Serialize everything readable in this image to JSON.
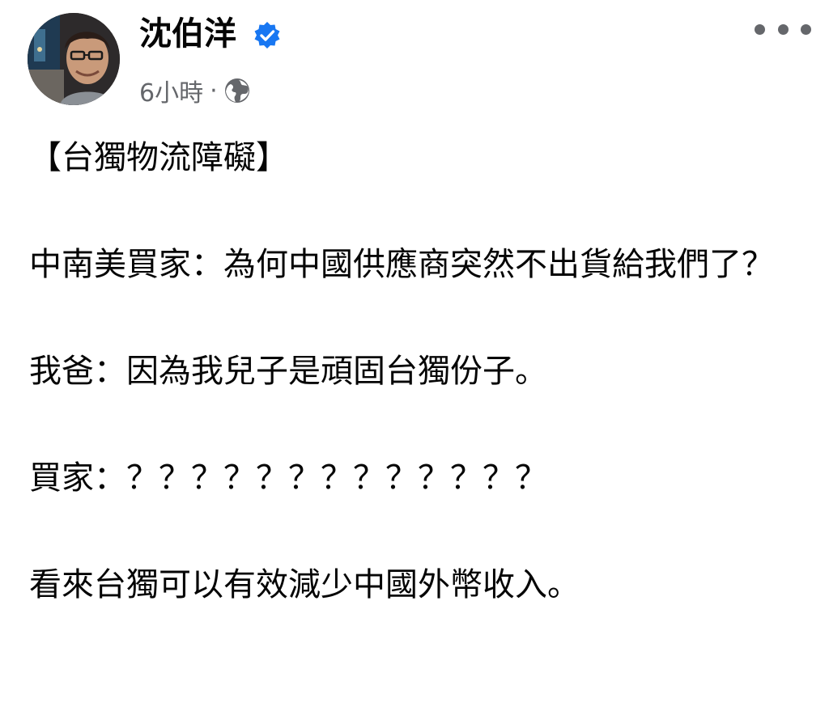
{
  "post": {
    "author": {
      "name": "沈伯洋",
      "verified": true,
      "avatar_icon": "profile-photo"
    },
    "meta": {
      "time": "6小時",
      "separator": "·",
      "audience_icon": "globe-icon"
    },
    "menu_icon": "more-horizontal-icon",
    "body": {
      "title": "【台獨物流障礙】",
      "paragraph_1": "中南美買家：為何中國供應商突然不出貨給我們了？",
      "paragraph_2": "我爸：因為我兒子是頑固台獨份子。",
      "paragraph_3": "買家：？？？？？？？？？？？？？",
      "paragraph_4": "看來台獨可以有效減少中國外幣收入。"
    }
  },
  "colors": {
    "text_primary": "#050505",
    "text_secondary": "#65676b",
    "verified_blue": "#1877f2",
    "background": "#ffffff"
  }
}
